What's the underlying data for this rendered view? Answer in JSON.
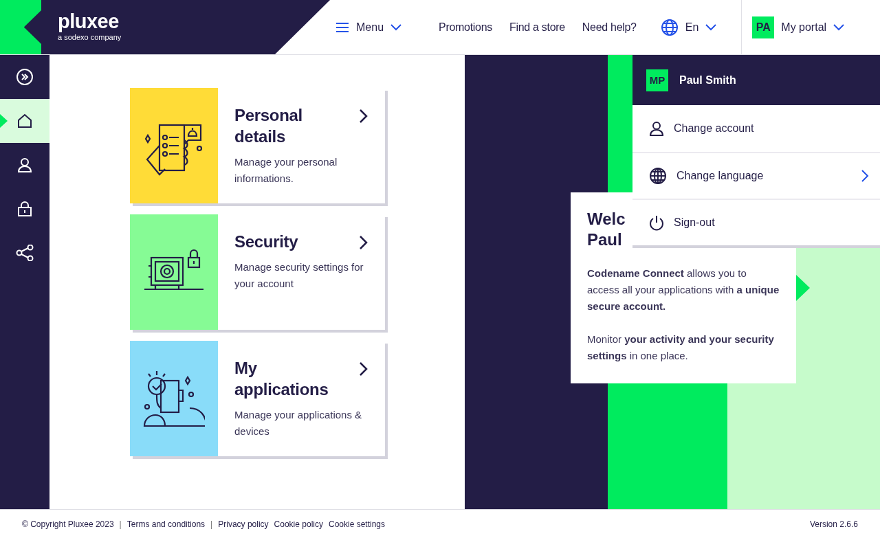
{
  "header": {
    "logo": "pluxee",
    "logo_tagline": "a sodexo company",
    "menu": "Menu",
    "nav": [
      "Promotions",
      "Find a store",
      "Need help?"
    ],
    "language": "En",
    "portal_avatar": "PA",
    "portal": "My portal"
  },
  "sidebar": {
    "items": [
      {
        "kind": "expand",
        "selected": false
      },
      {
        "kind": "home",
        "selected": true
      },
      {
        "kind": "user",
        "selected": false
      },
      {
        "kind": "lock",
        "selected": false
      },
      {
        "kind": "share",
        "selected": false
      }
    ]
  },
  "cards": [
    {
      "kind": "personal",
      "title": "Personal details",
      "description": "Manage your personal informations.",
      "color": "#ffdc37"
    },
    {
      "kind": "security",
      "title": "Security",
      "description": "Manage security settings for your account",
      "color": "#86fb95"
    },
    {
      "kind": "applications",
      "title": "My applications",
      "description": "Manage your applications & devices",
      "color": "#89dcf9"
    }
  ],
  "welcome": {
    "title_lines": [
      "Welc",
      "Paul"
    ],
    "paragraphs": [
      "**Codename Connect** allows you to access all your applications with **a unique secure account.**",
      "Monitor **your activity and your security settings** in one place."
    ]
  },
  "dropdown": {
    "avatar": "MP",
    "name": "Paul Smith",
    "items": [
      {
        "kind": "account",
        "label": "Change account",
        "submenu": false
      },
      {
        "kind": "language",
        "label": "Change language",
        "submenu": true
      },
      {
        "kind": "signout",
        "label": "Sign-out",
        "submenu": false
      }
    ]
  },
  "footer": {
    "items": [
      {
        "kind": "text",
        "label": "© Copyright Pluxee 2023"
      },
      {
        "kind": "separator",
        "label": "|"
      },
      {
        "kind": "link",
        "label": "Terms and conditions"
      },
      {
        "kind": "separator",
        "label": "|"
      },
      {
        "kind": "link",
        "label": "Privacy policy"
      },
      {
        "kind": "link",
        "label": "Cookie policy"
      },
      {
        "kind": "link",
        "label": "Cookie settings"
      }
    ],
    "version": "Version 2.6.6"
  }
}
